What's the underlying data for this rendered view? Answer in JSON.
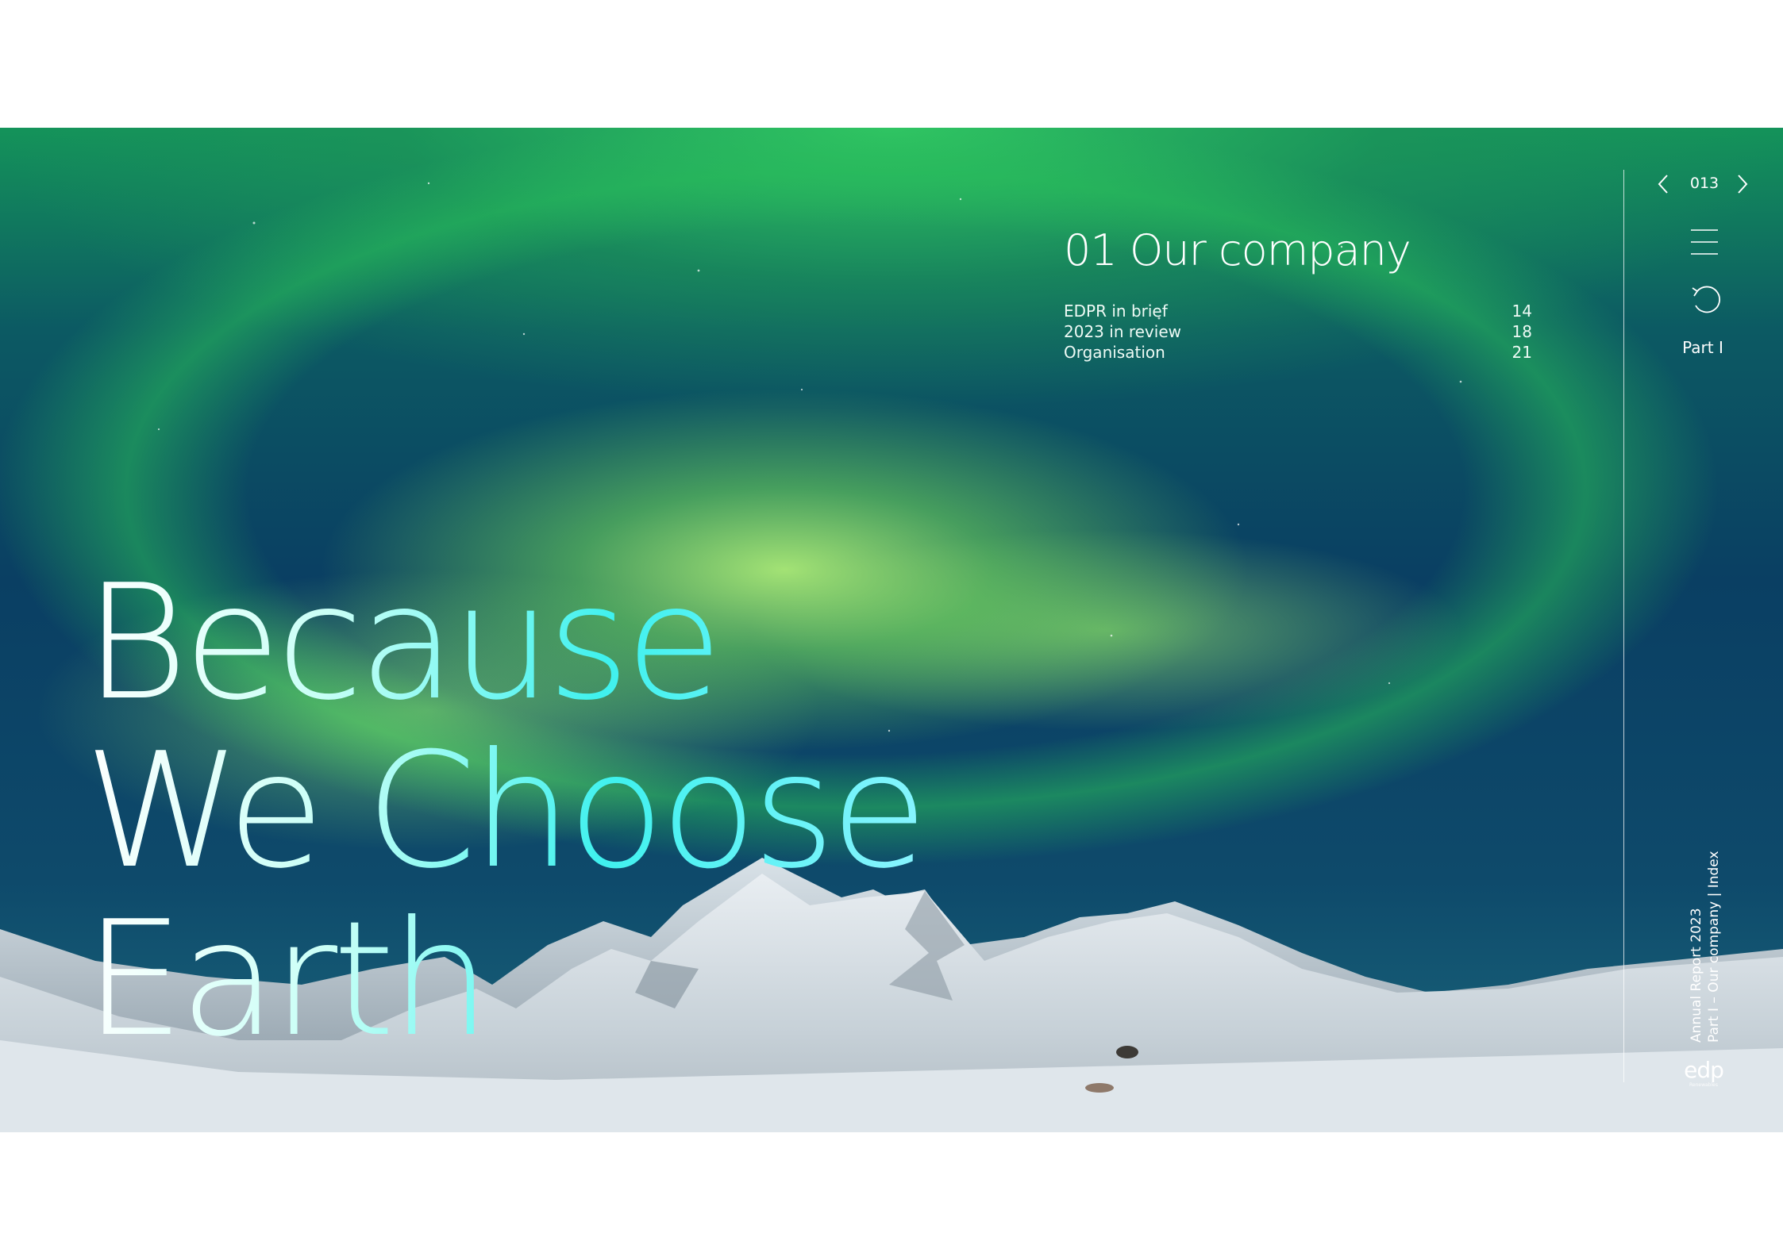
{
  "document": {
    "section_title": "01 Our company",
    "contents": [
      {
        "label": "EDPR in brief",
        "page": "14"
      },
      {
        "label": "2023 in review",
        "page": "18"
      },
      {
        "label": "Organisation",
        "page": "21"
      }
    ],
    "headline": [
      "Because",
      "We Choose",
      "Earth"
    ]
  },
  "navigation": {
    "page_number": "013",
    "prev_icon": "chevron-left-icon",
    "next_icon": "chevron-right-icon",
    "menu_icon": "hamburger-menu-icon",
    "back_icon": "undo-icon",
    "part_label": "Part I"
  },
  "footer": {
    "report_title": "Annual Report 2023",
    "breadcrumb": "Part I – Our company | Index",
    "logo_text": "edp",
    "logo_subtext": "Renewables"
  },
  "colors": {
    "aurora_green": "#6ee86a",
    "sky_blue": "#0a3f63",
    "headline_cyan": "#3ff1ee",
    "text": "#ffffff"
  }
}
